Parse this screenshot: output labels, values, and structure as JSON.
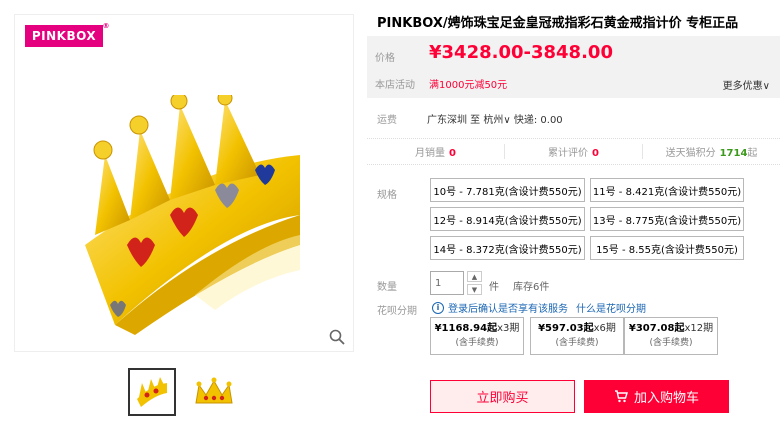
{
  "brand": {
    "logo_text": "PINKBOX",
    "reg_mark": "®"
  },
  "product": {
    "title": "PINKBOX/娉饰珠宝足金皇冠戒指彩石黄金戒指计价 专柜正品"
  },
  "price": {
    "label": "价格",
    "value": "¥3428.00-3848.00"
  },
  "promo": {
    "label": "本店活动",
    "value": "满1000元减50元",
    "more": "更多优惠∨"
  },
  "shipping": {
    "label": "运费",
    "text": "广东深圳 至 杭州∨ 快递: 0.00"
  },
  "stats": {
    "monthly_sales_label": "月销量",
    "monthly_sales": "0",
    "reviews_label": "累计评价",
    "reviews": "0",
    "points_label": "送天猫积分",
    "points": "1714",
    "points_suffix": "起"
  },
  "spec": {
    "label": "规格",
    "options": [
      "10号 - 7.781克(含设计费550元)",
      "11号 - 8.421克(含设计费550元)",
      "12号 - 8.914克(含设计费550元)",
      "13号 - 8.775克(含设计费550元)",
      "14号 - 8.372克(含设计费550元)",
      "15号 - 8.55克(含设计费550元)"
    ]
  },
  "quantity": {
    "label": "数量",
    "value": "1",
    "unit": "件",
    "stock": "库存6件",
    "up": "▲",
    "down": "▼"
  },
  "huabei": {
    "label": "花呗分期",
    "info": "登录后确认是否享有该服务",
    "link": "什么是花呗分期",
    "plans": [
      {
        "amount": "¥1168.94起",
        "periods": "x3期",
        "note": "(含手续费)"
      },
      {
        "amount": "¥597.03起",
        "periods": "x6期",
        "note": "(含手续费)"
      },
      {
        "amount": "¥307.08起",
        "periods": "x12期",
        "note": "(含手续费)"
      }
    ]
  },
  "actions": {
    "buy_now": "立即购买",
    "add_to_cart": "加入购物车"
  },
  "colors": {
    "accent": "#ff0036",
    "brand": "#e4007f",
    "gold": "#f2c200",
    "link": "#1a66b3"
  },
  "icons": {
    "zoom": "search-icon",
    "cart": "cart-icon",
    "info": "info-icon"
  }
}
